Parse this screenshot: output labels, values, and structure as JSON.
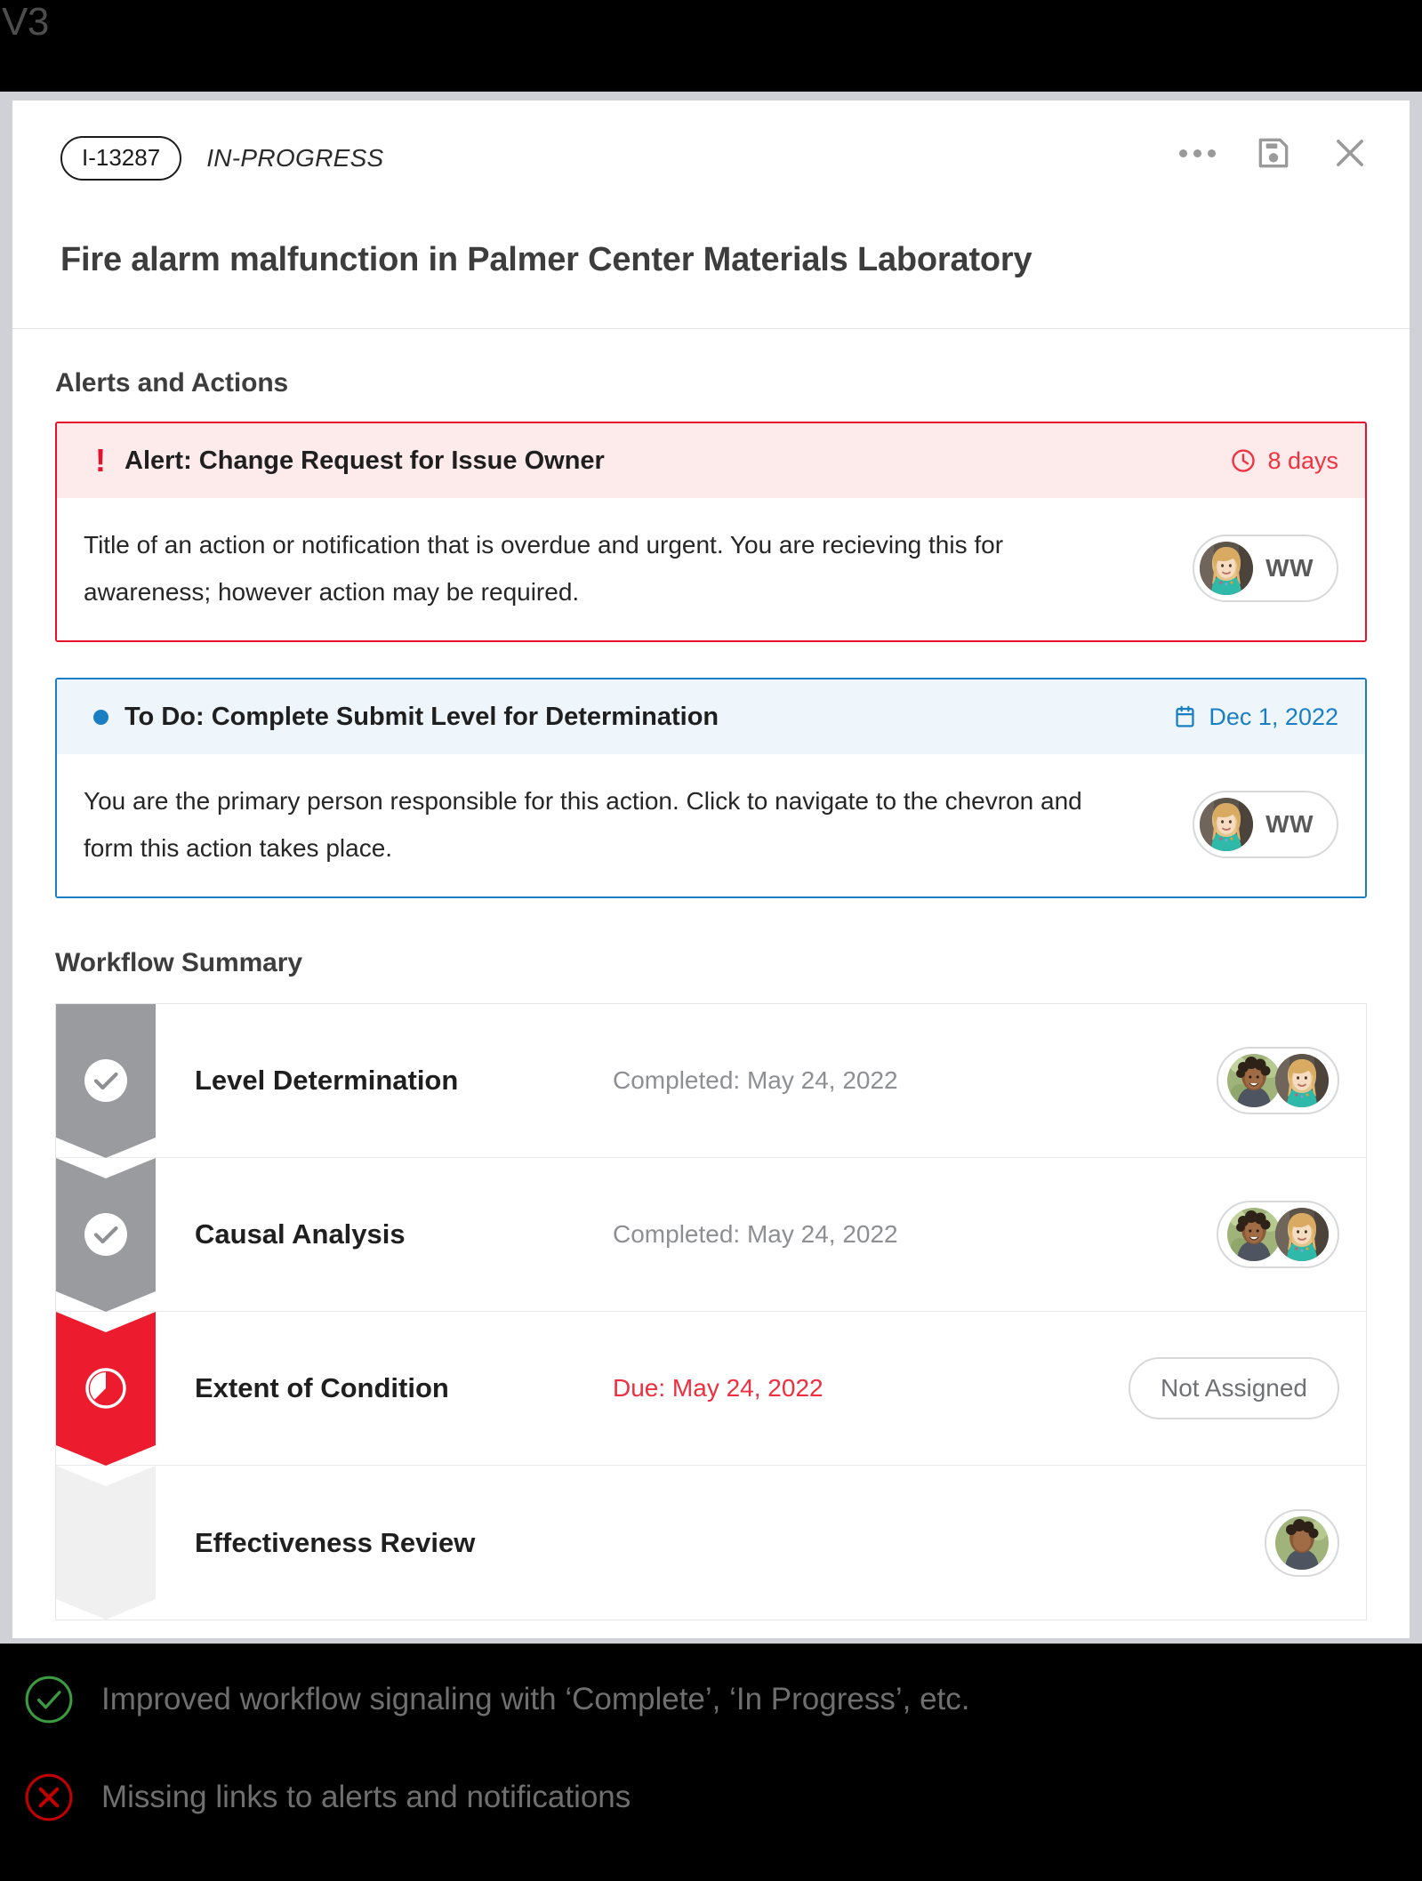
{
  "version_label": "V3",
  "header": {
    "issue_id": "I-13287",
    "status": "IN-PROGRESS",
    "title": "Fire alarm malfunction in Palmer Center Materials Laboratory",
    "actions": [
      {
        "name": "more-options",
        "icon": "ellipsis-icon"
      },
      {
        "name": "save",
        "icon": "save-icon"
      },
      {
        "name": "close",
        "icon": "close-icon"
      }
    ]
  },
  "alerts_section": {
    "title": "Alerts and Actions",
    "items": [
      {
        "type": "alert",
        "marker_icon": "exclamation-icon",
        "title": "Alert: Change Request for Issue Owner",
        "meta_icon": "clock-icon",
        "meta": "8 days",
        "body": "Title of an action or notification that is overdue and urgent. You are recieving this for awareness; however action may be required.",
        "assignee_initials": "WW",
        "accent": "#e8112d",
        "head_bg": "#fdebec"
      },
      {
        "type": "todo",
        "marker_icon": "dot-icon",
        "title": "To Do: Complete Submit Level for Determination",
        "meta_icon": "calendar-icon",
        "meta": "Dec 1, 2022",
        "body": "You are the primary person responsible for this action. Click to navigate to the chevron and form this action takes place.",
        "assignee_initials": "WW",
        "accent": "#1a7ec2",
        "head_bg": "#eef6fc"
      }
    ]
  },
  "workflow_section": {
    "title": "Workflow Summary",
    "rows": [
      {
        "name": "Level Determination",
        "date": "Completed: May 24, 2022",
        "state": "complete",
        "state_icon": "check-circle-icon",
        "rail_color": "#999b9e",
        "assignee_type": "avatars",
        "avatar_count": 2
      },
      {
        "name": "Causal Analysis",
        "date": "Completed: May 24, 2022",
        "state": "complete",
        "state_icon": "check-circle-icon",
        "rail_color": "#999b9e",
        "assignee_type": "avatars",
        "avatar_count": 2
      },
      {
        "name": "Extent of Condition",
        "date": "Due: May 24, 2022",
        "state": "overdue",
        "state_icon": "half-circle-icon",
        "rail_color": "#ec1c2e",
        "assignee_type": "not-assigned",
        "not_assigned_label": "Not Assigned"
      },
      {
        "name": "Effectiveness Review",
        "date": "",
        "state": "upcoming",
        "state_icon": "",
        "rail_color": "#f0f0f0",
        "assignee_type": "avatars",
        "avatar_count": 1
      }
    ]
  },
  "footer_notes": [
    {
      "icon": "check-circle-outline-icon",
      "color": "#3c9a41",
      "text": "Improved workflow signaling with ‘Complete’, ‘In Progress’, etc."
    },
    {
      "icon": "x-circle-outline-icon",
      "color": "#c00000",
      "text": "Missing links to alerts and notifications"
    }
  ]
}
